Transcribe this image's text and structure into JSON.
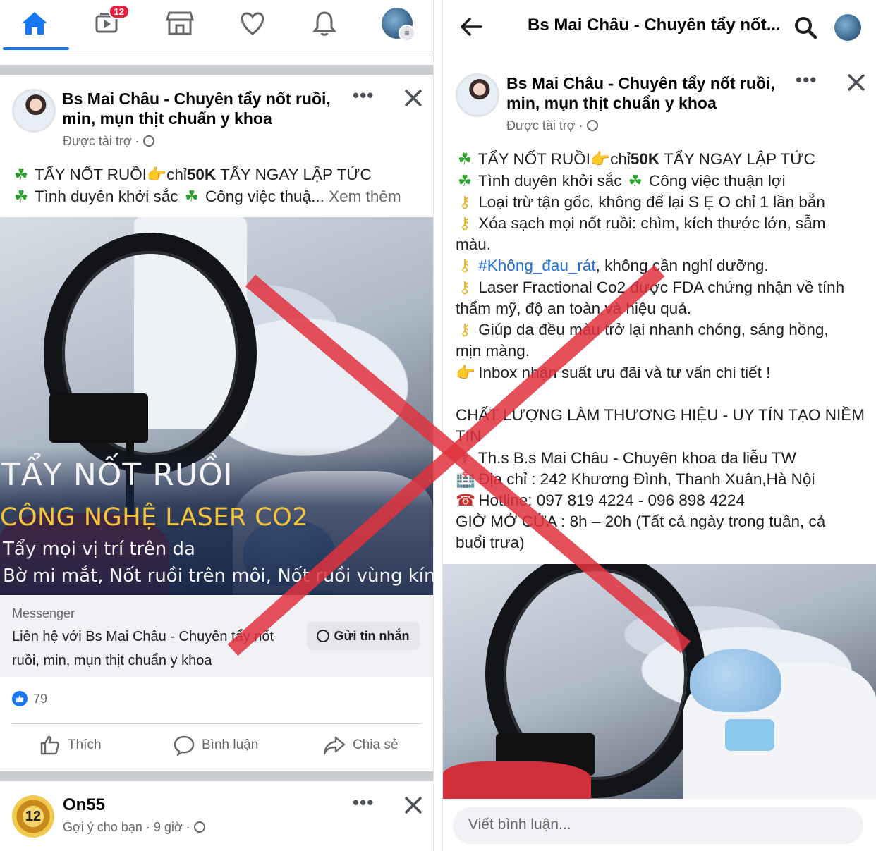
{
  "nav": {
    "watch_badge": "12"
  },
  "left_post": {
    "page_name_line1": "Bs Mai Châu - Chuyên tẩy nốt ruồi,",
    "page_name_line2": "min, mụn thịt chuẩn y khoa",
    "sponsored": "Được tài trợ · ",
    "more": "•••",
    "text_line1_a": "TẨY NỐT RUỒI",
    "text_line1_b": "chỉ",
    "text_line1_c": "50K",
    "text_line1_d": " TẨY NGAY LẬP TỨC",
    "text_line2_a": "Tình duyên khởi sắc ",
    "text_line2_b": " Công việc thuậ...",
    "see_more": " Xem thêm",
    "ad_title": "TẨY NỐT RUỒI",
    "ad_subtitle": "CÔNG NGHỆ LASER CO2",
    "ad_line3": "Tẩy mọi vị trí trên da",
    "ad_line4": "Bờ mi mắt, Nốt ruồi trên môi, Nốt ruồi vùng kín",
    "cta_source": "Messenger",
    "cta_text": "Liên hệ với Bs Mai Châu - Chuyên tẩy nốt ruồi, min, mụn thịt chuẩn y khoa",
    "cta_button": "Gửi tin nhắn",
    "like_count": "79",
    "action_like": "Thích",
    "action_comment": "Bình luận",
    "action_share": "Chia sẻ"
  },
  "next_post": {
    "page_name": "On55",
    "avatar_text": "12",
    "meta": "Gợi ý cho bạn · 9 giờ · ",
    "more": "•••"
  },
  "right_post": {
    "header_title": "Bs Mai Châu - Chuyên tẩy nốt...",
    "page_name_line1": "Bs Mai Châu - Chuyên tẩy nốt ruồi,",
    "page_name_line2": "min, mụn thịt chuẩn y khoa",
    "sponsored": "Được tài trợ · ",
    "more": "•••",
    "l1_a": "TẨY NỐT RUỒI",
    "l1_b": "chỉ",
    "l1_c": "50K",
    "l1_d": " TẨY NGAY LẬP TỨC",
    "l2_a": "Tình duyên khởi sắc ",
    "l2_b": " Công việc thuận lợi",
    "l3": "Loại trừ tận gốc, không để lại S Ẹ O chỉ 1 lần bắn",
    "l4": "Xóa sạch mọi nốt ruồi: chìm, kích thước lớn, sẫm",
    "l5": "màu.",
    "l6_tag": "#Không_đau_rát",
    "l6_rest": ", không cần nghỉ dưỡng.",
    "l7": "Laser Fractional Co2 được FDA chứng nhận về tính",
    "l8": "thẩm mỹ, độ an toàn và hiệu quả.",
    "l9": "Giúp da đều màu trở lại nhanh chóng, sáng hồng,",
    "l10": "mịn màng.",
    "l11": "Inbox nhận suất ưu đãi và tư vấn chi tiết !",
    "l12": "CHẤT LƯỢNG LÀM THƯƠNG HIỆU - UY TÍN TẠO NIỀM",
    "l13": "TIN",
    "l14": "Th.s B.s Mai Châu - Chuyên khoa da liễu TW",
    "l15": "Địa chỉ : 242 Khương Đình, Thanh Xuân,Hà Nội",
    "l16": "Hotline: 097 819 4224 - 096 898 4224",
    "l17": "GIỜ MỞ CỬA : 8h – 20h (Tất cả ngày trong tuần, cả",
    "l18": "buổi trưa)",
    "comment_placeholder": "Viết bình luận..."
  },
  "colors": {
    "accent": "#1877f2",
    "cross": "#e0323e",
    "badge": "#e41e3f"
  }
}
